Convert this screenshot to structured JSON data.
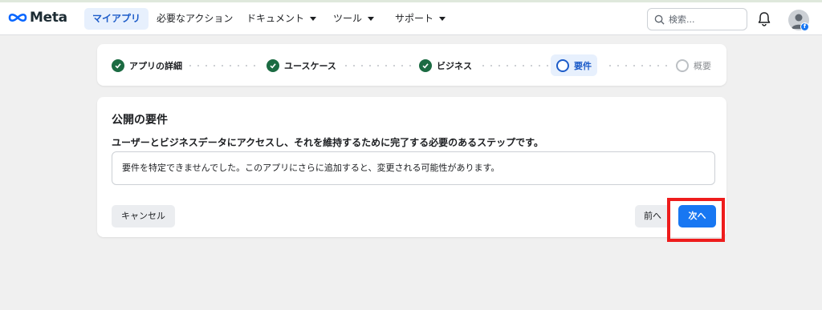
{
  "brand": {
    "logo_text": "Meta",
    "accent": "#1877f2",
    "success": "#1b6b42",
    "highlight": "#ee1c1c"
  },
  "nav": {
    "items": [
      {
        "label": "マイアプリ",
        "active": true
      },
      {
        "label": "必要なアクション",
        "active": false
      },
      {
        "label": "ドキュメント",
        "dropdown": true
      },
      {
        "label": "ツール",
        "dropdown": true
      },
      {
        "label": "サポート",
        "dropdown": true
      }
    ],
    "search_placeholder": "検索...",
    "icons": [
      "search-icon",
      "bell-icon",
      "avatar",
      "facebook-badge-icon"
    ]
  },
  "stepper": {
    "steps": [
      {
        "label": "アプリの詳細",
        "state": "done"
      },
      {
        "label": "ユースケース",
        "state": "done"
      },
      {
        "label": "ビジネス",
        "state": "done"
      },
      {
        "label": "要件",
        "state": "current"
      },
      {
        "label": "概要",
        "state": "future"
      }
    ]
  },
  "panel": {
    "title": "公開の要件",
    "subtitle": "ユーザーとビジネスデータにアクセスし、それを維持するために完了する必要のあるステップです。",
    "notice": "要件を特定できませんでした。このアプリにさらに追加すると、変更される可能性があります。",
    "cancel_label": "キャンセル",
    "prev_label": "前へ",
    "next_label": "次へ"
  }
}
